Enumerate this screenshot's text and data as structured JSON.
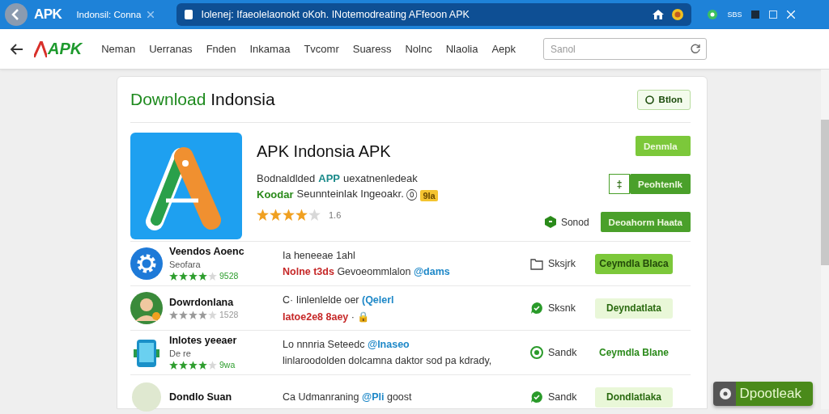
{
  "browser": {
    "logo": "APK",
    "tab_title": "Indonsil: Conna",
    "url": "Iolenej: Ifaeolelaonokt oKoh. INotemodreating AFfeoon APK",
    "profile": "SBS"
  },
  "site": {
    "logo": "APK",
    "nav": [
      "Neman",
      "Uerranas",
      "Fnden",
      "Inkamaa",
      "Tvcomr",
      "Suaress",
      "Nolnc",
      "Nlaolia",
      "Aepk"
    ],
    "search": {
      "placeholder": "Sanol"
    }
  },
  "page": {
    "title_lead": "Download",
    "title_rest": "Indonsia",
    "filter_button": "Btlon"
  },
  "featured": {
    "name": "APK Indonsia APK",
    "line1": [
      {
        "kind": "plain",
        "text": "Bodnaldlded"
      },
      {
        "kind": "teal",
        "text": "APP"
      },
      {
        "kind": "plain",
        "text": "uexatnenledeak"
      }
    ],
    "line2": [
      {
        "kind": "green",
        "text": "Koodar"
      },
      {
        "kind": "plain",
        "text": "Seunnteinlak Ingeoakr. 🄋"
      }
    ],
    "badge": "9Ia",
    "stars": 4,
    "rating": "1.6",
    "buttons": [
      {
        "kind": "solid",
        "label": "Denmla"
      },
      {
        "kind": "split",
        "label": "Peohtenlk",
        "side": "‡"
      },
      {
        "kind": "solid",
        "label": "Deoahorm Haata",
        "note": "Sonod"
      }
    ]
  },
  "rows": [
    {
      "name": "Veendos Aoenc",
      "sub": "Seofara",
      "stars": 4,
      "color": "#2e9e2e",
      "rating": "9528",
      "line1": [
        {
          "kind": "plain",
          "text": "Ia heneeae 1ahl"
        }
      ],
      "line2": [
        {
          "kind": "red",
          "text": "Nolne t3ds"
        },
        {
          "kind": "plain",
          "text": "Gevoeommlalon"
        },
        {
          "kind": "blue",
          "text": "@dams"
        }
      ],
      "action": {
        "label": "Sksjrk"
      },
      "button": {
        "kind": "solid",
        "label": "Ceymdla Blaca"
      }
    },
    {
      "name": "Dowrdonlana",
      "stars": 4,
      "color": "#9a9a9a",
      "rating": "1528",
      "line1": [
        {
          "kind": "plain",
          "text": "C· Iinlenlelde oer"
        },
        {
          "kind": "blue",
          "text": "(Qelerl"
        }
      ],
      "line2": [
        {
          "kind": "red",
          "text": "Iatoe2e8 8aey"
        },
        {
          "kind": "plain",
          "text": "· 🔒"
        }
      ],
      "action": {
        "label": "Sksnk"
      },
      "button": {
        "kind": "light",
        "label": "Deyndatlata"
      }
    },
    {
      "name": "Inlotes yeeaer",
      "sub": "De re",
      "stars": 4,
      "color": "#2e9e2e",
      "rating": "9wa",
      "line1": [
        {
          "kind": "plain",
          "text": "Lo nnnria Seteedc"
        },
        {
          "kind": "blue",
          "text": "@lnaseo"
        }
      ],
      "line2": [
        {
          "kind": "plain",
          "text": "linlaroodolden dolcamna daktor sod pa kdrady,"
        }
      ],
      "action": {
        "label": "Sandk"
      },
      "button": {
        "kind": "text",
        "label": "Ceymdla Blane"
      }
    },
    {
      "name": "Dondlo Suan",
      "line1": [
        {
          "kind": "plain",
          "text": "Ca Udmanraning"
        },
        {
          "kind": "blue",
          "text": "@Pli"
        },
        {
          "kind": "plain",
          "text": "goost"
        }
      ],
      "action": {
        "label": "Sandk"
      },
      "button": {
        "kind": "light",
        "label": "Dondlatlaka"
      }
    }
  ],
  "floating_button": {
    "label": "Dpootleak"
  }
}
